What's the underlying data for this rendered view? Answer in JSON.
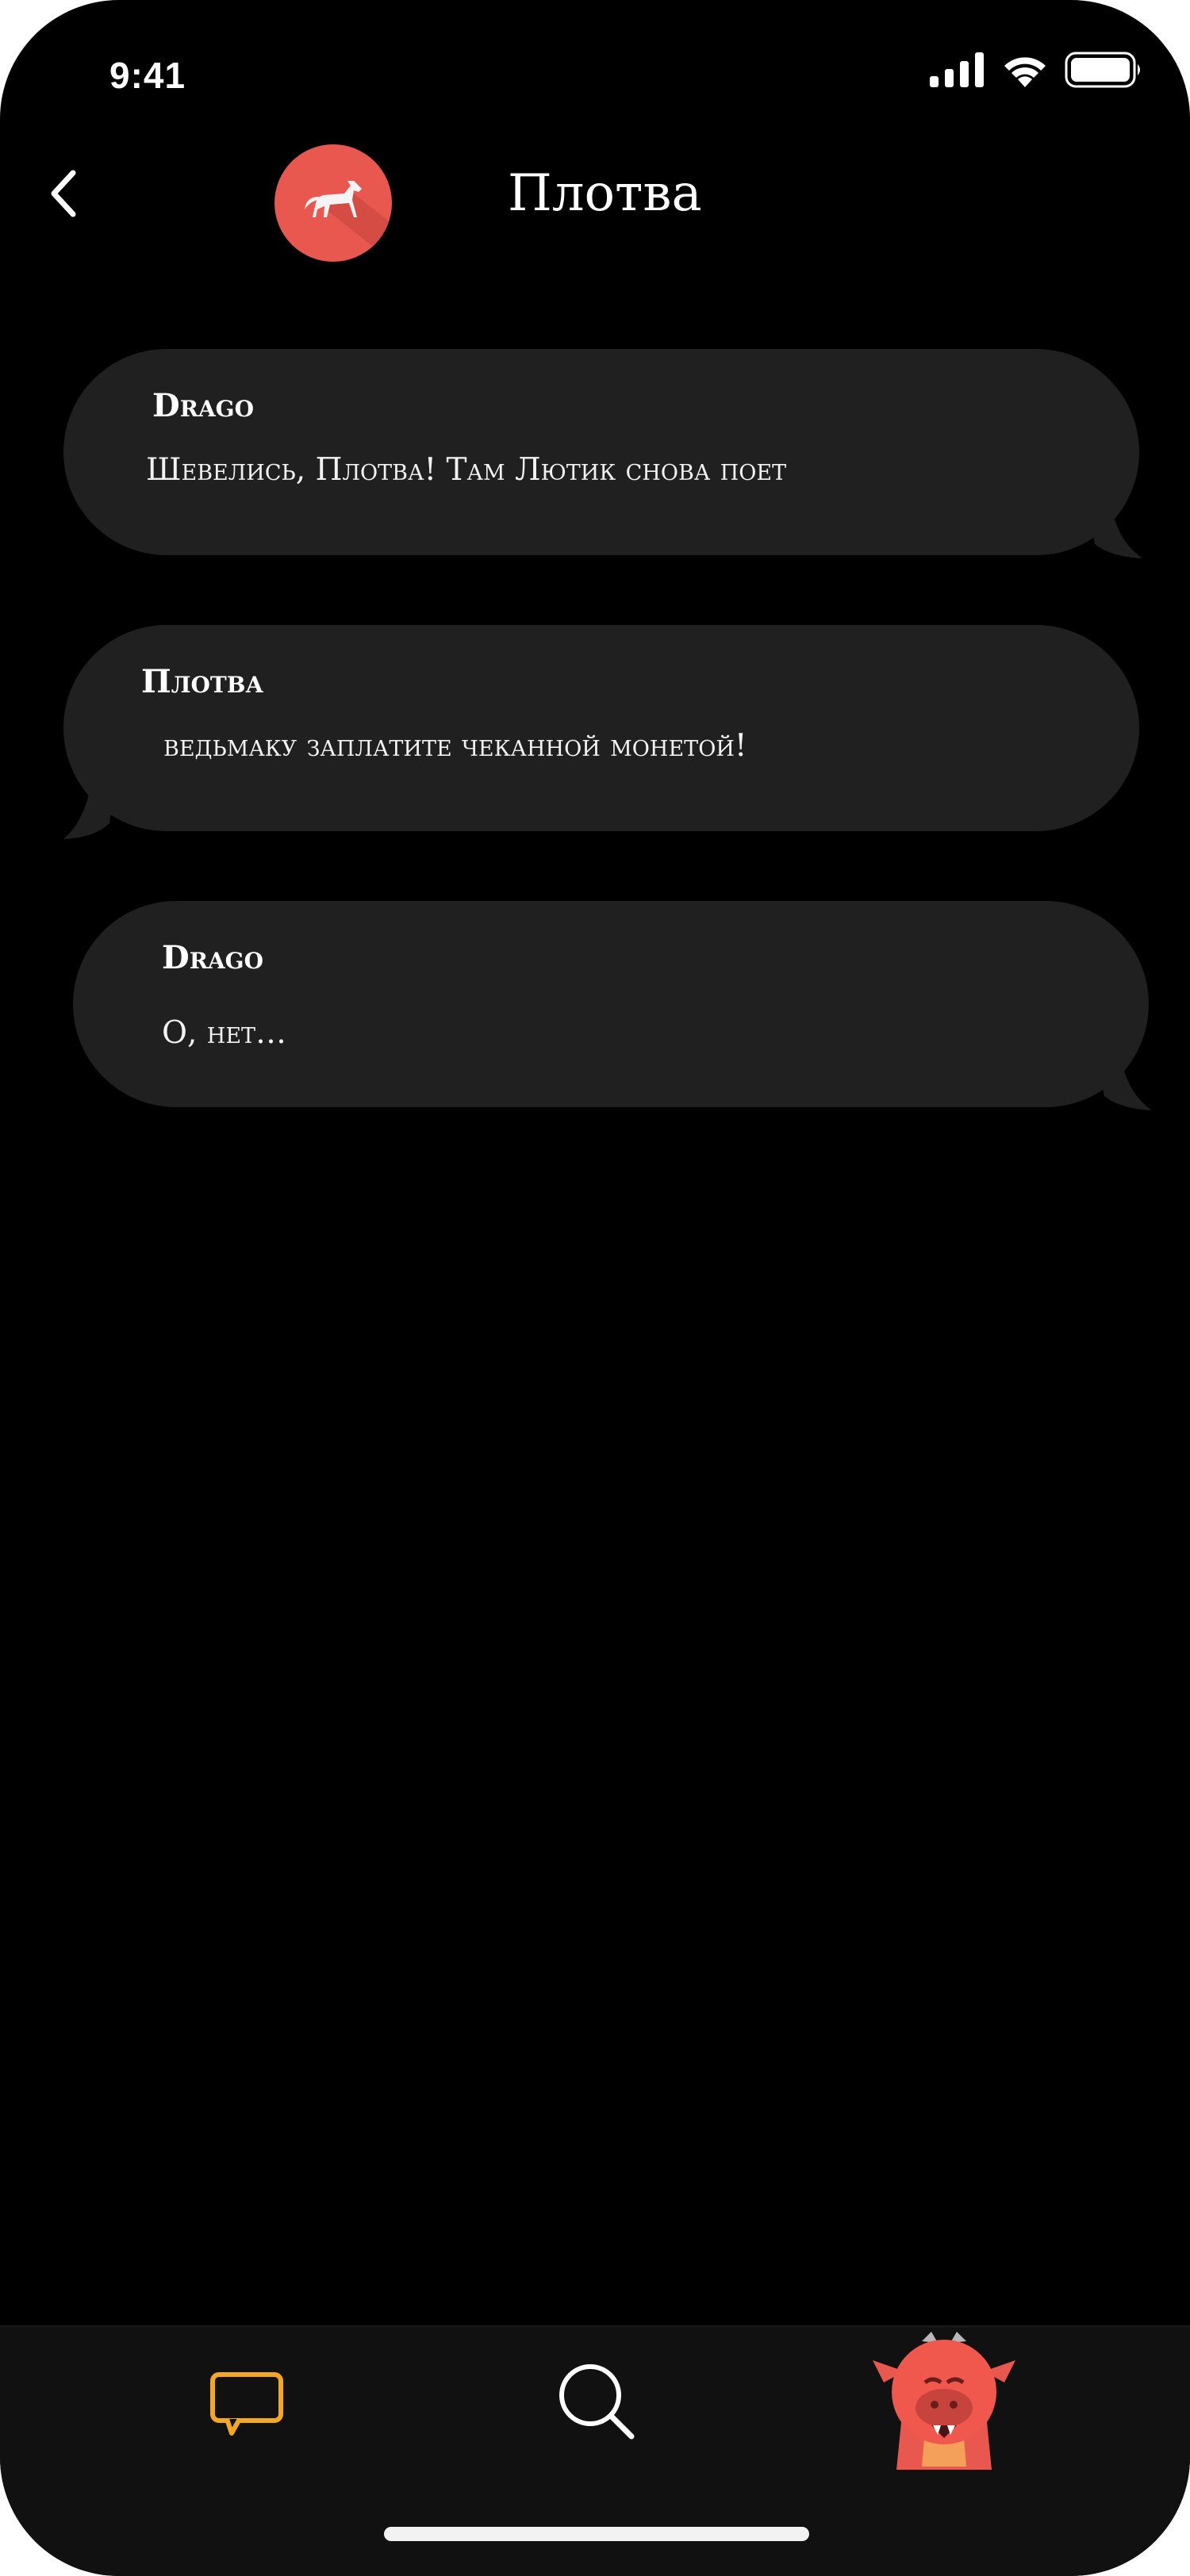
{
  "status_bar": {
    "time": "9:41"
  },
  "header": {
    "title": "Плотва",
    "avatar_icon": "horse-avatar-icon"
  },
  "messages": [
    {
      "sender": "Drago",
      "text": "Шевелись, Плотва! Там Лютик снова поет"
    },
    {
      "sender": "Плотва",
      "text": "ведьмаку заплатите чеканной монетой!"
    },
    {
      "sender": "Drago",
      "text": "О, нет…"
    }
  ],
  "tabbar": {
    "items": [
      {
        "name": "chats",
        "icon": "chat-bubble-icon",
        "active": true
      },
      {
        "name": "search",
        "icon": "search-icon",
        "active": false
      },
      {
        "name": "profile",
        "icon": "dragon-avatar-icon",
        "active": false
      }
    ]
  },
  "colors": {
    "background": "#000000",
    "bubble": "#202020",
    "accent": "#f5a623",
    "avatar": "#e8584f"
  }
}
